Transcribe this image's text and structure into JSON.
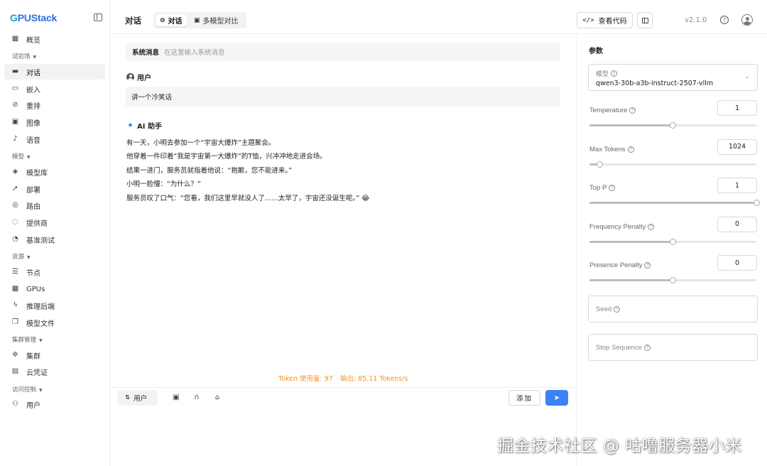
{
  "app": {
    "logo": "GPUStack",
    "version": "v2.1.0"
  },
  "sidebar": {
    "overview": "概览",
    "groups": {
      "playground": "试验场",
      "models": "模型",
      "resources": "资源",
      "cluster": "集群管理",
      "access": "访问控制"
    },
    "items": {
      "chat": "对话",
      "embedding": "嵌入",
      "rerank": "重排",
      "image": "图像",
      "audio": "语音",
      "catalog": "模型库",
      "deployments": "部署",
      "routes": "路由",
      "providers": "提供商",
      "benchmark": "基准测试",
      "nodes": "节点",
      "gpus": "GPUs",
      "backends": "推理后端",
      "model_files": "模型文件",
      "clusters": "集群",
      "credentials": "云凭证",
      "users": "用户"
    }
  },
  "topbar": {
    "title": "对话",
    "tabs": [
      "对话",
      "多模型对比"
    ],
    "view_code": "查看代码"
  },
  "chat": {
    "system_label": "系统消息",
    "system_placeholder": "在这里输入系统消息",
    "user_role": "用户",
    "user_message": "讲一个冷笑话",
    "assistant_role": "AI 助手",
    "assistant_lines": [
      "有一天，小明去参加一个“宇宙大爆炸”主题聚会。",
      "他穿着一件印着“我是宇宙第一大爆炸”的T恤，兴冲冲地走进会场。",
      "结果一进门，服务员就指着他说：“抱歉，您不能进来。”",
      "小明一脸懵：“为什么？”",
      "服务员叹了口气：“您看，我们这里早就没人了……太早了，宇宙还没诞生呢。” 😂"
    ],
    "token_usage": "Token 使用量: 97",
    "output_rate": "输出: 85.11 Tokens/s",
    "role_button": "用户",
    "add_button": "添加"
  },
  "params": {
    "title": "参数",
    "model_label": "模型",
    "model_value": "qwen3-30b-a3b-instruct-2507-vllm",
    "items": [
      {
        "label": "Temperature",
        "value": "1",
        "level": 0.5
      },
      {
        "label": "Max Tokens",
        "value": "1024",
        "level": 0.06
      },
      {
        "label": "Top P",
        "value": "1",
        "level": 1.0
      },
      {
        "label": "Frequency Penalty",
        "value": "0",
        "level": 0.5
      },
      {
        "label": "Presence Penalty",
        "value": "0",
        "level": 0.5
      }
    ],
    "seed_label": "Seed",
    "stop_label": "Stop Sequence"
  },
  "watermark": "掘金技术社区 @ 咕噜服务器小米"
}
